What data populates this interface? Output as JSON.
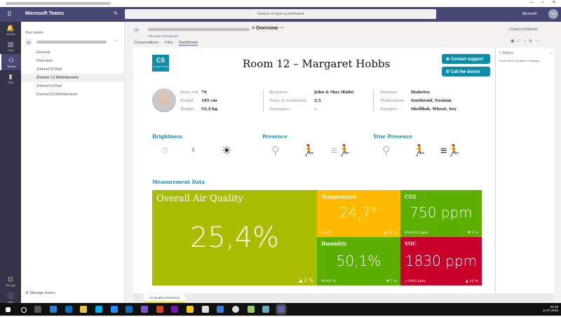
{
  "app": {
    "name": "Microsoft Teams",
    "search_placeholder": "Search or type a command",
    "org": "Microsoft",
    "avatar_initials": "MG"
  },
  "rail": [
    {
      "label": "Activity",
      "icon": "bell-icon"
    },
    {
      "label": "Chat",
      "icon": "chat-icon"
    },
    {
      "label": "Teams",
      "icon": "teams-icon"
    },
    {
      "label": "Files",
      "icon": "file-icon"
    }
  ],
  "rail_bottom": [
    {
      "label": "Get app"
    },
    {
      "label": "Help"
    }
  ],
  "sidebar": {
    "heading": "Your teams",
    "team_badge": "C6",
    "team_more": "···",
    "channels": [
      "General",
      "Overview",
      "Zimmer12.Bad",
      "Zimmer 12.Wohnbereich",
      "Zimmer13.Bad",
      "Zimmer13.Wohnbereich"
    ],
    "manage": "Manage teams"
  },
  "channel_header": {
    "badge": "C6",
    "crumb_sep": ">",
    "title": "Overview",
    "more": "···",
    "guests": "This team has guests",
    "tabs": [
      "Conversations",
      "Files",
      "Dashboard"
    ],
    "active_tab": "Dashboard",
    "privacy": "Private",
    "classification": "Confidential"
  },
  "dashboard": {
    "logo": "CS",
    "logo_sub": "Caretaker Solutions",
    "title": "Room 12 – Margaret Hobbs",
    "buttons": {
      "contact": "Contact support",
      "call": "Call the doctor"
    },
    "info": [
      [
        {
          "k": "Years old",
          "v": "76"
        },
        {
          "k": "Height",
          "v": "165 cm"
        },
        {
          "k": "Weight",
          "v": "53,4 kg"
        }
      ],
      [
        {
          "k": "Relatives",
          "v": "John & May (Kids)"
        },
        {
          "k": "Years in institution",
          "v": "2,5"
        },
        {
          "k": "Anomalies",
          "v": "-"
        }
      ],
      [
        {
          "k": "Diseases",
          "v": "Diabetes"
        },
        {
          "k": "Medications",
          "v": "Synthroid, Nexium"
        },
        {
          "k": "Allergies",
          "v": "Shellfish, Wheat, Soy"
        }
      ]
    ],
    "brightness": "Brightness",
    "presence": "Presence",
    "true_presence": "True Presence",
    "measurement": "Measurement Data",
    "tiles": {
      "overall": {
        "title": "Overall Air Quality",
        "value": "25,4%",
        "delta": "▲ 2 %",
        "color": "#a8bd00"
      },
      "temp": {
        "title": "Temperature",
        "value": "24,7°",
        "range": "16-25°",
        "delta": "▲ 18 %",
        "color": "#ffba00"
      },
      "co2": {
        "title": "CO2",
        "value": "750 ppm",
        "range": "450-850 ppm",
        "delta": "▼ 5 %",
        "color": "#5aaf00"
      },
      "hum": {
        "title": "Humidity",
        "value": "50,1%",
        "range": "40-60 %",
        "delta": "▼ 7 %",
        "color": "#5aaf00"
      },
      "voc": {
        "title": "VOC",
        "value": "1830 ppm",
        "range": "<1000 ppm",
        "delta": "▲ 16 %",
        "color": "#c8002a"
      }
    }
  },
  "filters": {
    "title": "Filters",
    "empty": "There aren't any filters to display."
  },
  "report_tab": "Air Quality Monitoring",
  "clock": {
    "time": "09:38",
    "date": "11.07.2019"
  }
}
